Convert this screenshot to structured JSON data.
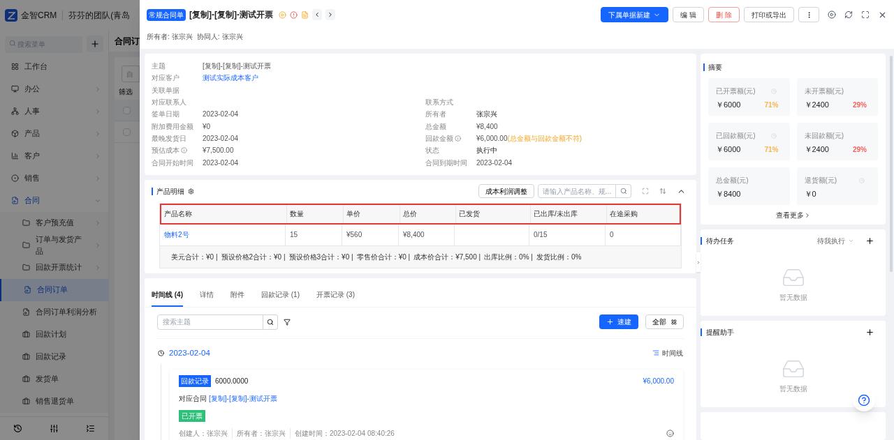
{
  "app": {
    "logo_text": "金智CRM",
    "team": "芬芬的团队(青岛",
    "search_placeholder": "搜索菜单",
    "menu": [
      {
        "label": "工作台",
        "kind": "link",
        "selected": false
      },
      {
        "label": "办公",
        "kind": "group",
        "expanded": false,
        "selected": false
      },
      {
        "label": "人事",
        "kind": "group",
        "expanded": false,
        "selected": false
      },
      {
        "label": "产品",
        "kind": "group",
        "expanded": false,
        "selected": false
      },
      {
        "label": "客户",
        "kind": "group",
        "expanded": false,
        "selected": false
      },
      {
        "label": "销售",
        "kind": "group",
        "expanded": false,
        "selected": false
      },
      {
        "label": "合同",
        "kind": "group",
        "expanded": true,
        "selected": false,
        "children": [
          {
            "label": "客户预充值",
            "kind": "folder",
            "selected": false
          },
          {
            "label": "订单与发货产品",
            "kind": "folder",
            "selected": false
          },
          {
            "label": "回款开票统计",
            "kind": "folder",
            "selected": false
          },
          {
            "label": "合同订单",
            "kind": "page",
            "selected": true
          },
          {
            "label": "合同订单利润分析",
            "kind": "page",
            "selected": false
          },
          {
            "label": "回款计划",
            "kind": "case",
            "selected": false
          },
          {
            "label": "回款记录",
            "kind": "case",
            "selected": false
          },
          {
            "label": "发货单",
            "kind": "case",
            "selected": false
          },
          {
            "label": "销售退货单",
            "kind": "case",
            "selected": false
          }
        ]
      }
    ],
    "page_title": "合同订",
    "filter_value": "自",
    "filter_label": "筛选",
    "table_rows": [
      {
        "checked": false
      },
      {
        "checked": false
      }
    ]
  },
  "drawer": {
    "type_badge": "常规合同单",
    "title": "[复制]-[复制]-测试开票",
    "actions": [
      {
        "label": "下属单据新建",
        "kind": "primary"
      },
      {
        "label": "编 辑",
        "kind": "default"
      },
      {
        "label": "删 除",
        "kind": "danger"
      },
      {
        "label": "打印或导出",
        "kind": "default"
      }
    ],
    "people": [
      {
        "label": "所有者:",
        "value": "张宗兴"
      },
      {
        "label": "协同人:",
        "value": "张宗兴"
      }
    ],
    "info_rows": [
      {
        "left": {
          "label": "主题",
          "value": "[复制]-[复制]-测试开票"
        }
      },
      {
        "left": {
          "label": "对应客户",
          "value": "测试实际成本客户",
          "kind": "link"
        }
      },
      {
        "left": {
          "label": "关联单据"
        }
      },
      {
        "left": {
          "label": "对应联系人"
        },
        "right": {
          "label": "联系方式"
        }
      },
      {
        "left": {
          "label": "签单日期",
          "value": "2023-02-04"
        },
        "right": {
          "label": "所有者",
          "value": "张宗兴",
          "kind": "strong"
        }
      },
      {
        "left": {
          "label": "附加费用金额",
          "value": "¥0"
        },
        "right": {
          "label": "总金额",
          "value": "¥8,400"
        }
      },
      {
        "left": {
          "label": "最晚发货日",
          "value": "2023-02-04"
        },
        "right": {
          "label": "回款金额",
          "info": true,
          "value": "¥6,000.00",
          "warning": "(总金额与回款金额不符)"
        }
      },
      {
        "left": {
          "label": "预估成本",
          "info": true,
          "value": "¥7,500.00"
        },
        "right": {
          "label": "状态",
          "value": "执行中",
          "kind": "strong"
        }
      },
      {
        "left": {
          "label": "合同开始时间",
          "value": "2023-02-04"
        },
        "right": {
          "label": "合同到期时间",
          "value": "2023-02-04"
        }
      }
    ],
    "products": {
      "title": "产品明细",
      "adjust_button": "成本利润调整",
      "search_placeholder": "请输入产品名称、规...",
      "columns": [
        "产品名称",
        "数量",
        "单价",
        "总价",
        "已发货",
        "已出库/未出库",
        "在途采购"
      ],
      "rows": [
        {
          "cells": [
            "物料2号",
            "15",
            "¥560",
            "¥8,400",
            null,
            "0/15",
            "0"
          ]
        }
      ],
      "totals": [
        "美元合计：¥0 |",
        "预设价格2合计：¥0 |",
        "预设价格3合计：¥0 |",
        "零售价合计：¥0 |",
        "成本价合计：¥7,500 |",
        "出库比例：0% |",
        "发货比例：0%"
      ]
    },
    "tabs": [
      {
        "label": "时间线 (4)",
        "selected": true
      },
      {
        "label": "详情",
        "selected": false
      },
      {
        "label": "附件",
        "selected": false
      },
      {
        "label": "回款记录 (1)",
        "selected": false
      },
      {
        "label": "开票记录 (3)",
        "selected": false
      }
    ],
    "timeline": {
      "search_placeholder": "搜索主题",
      "quick_button": "速建",
      "all_button": "全部",
      "date": "2023-02-04",
      "view_toggle": "时间线",
      "entries": [
        {
          "tag": "回款记录",
          "number": "6000.0000",
          "amount": "¥6,000.00",
          "relation_label": "对应合同",
          "relation_link": "[复制]-[复制]-测试开票",
          "status": "已开票",
          "meta": [
            "创建人：张宗兴",
            "所有者：张宗兴",
            "创建时间：2023-02-04 08:40:26"
          ]
        }
      ]
    },
    "summary": {
      "title": "摘要",
      "more": "查看更多",
      "stats": [
        {
          "label": "已开票额(元)",
          "value": "￥6000",
          "percent": "71%",
          "color": "#f5b454",
          "clock": true
        },
        {
          "label": "未开票额(元)",
          "value": "￥2400",
          "percent": "29%",
          "color": "#f2625c",
          "clock": false
        },
        {
          "label": "已回款额(元)",
          "value": "￥6000",
          "percent": "71%",
          "color": "#f5b454",
          "clock": true
        },
        {
          "label": "未回款额(元)",
          "value": "￥2400",
          "percent": "29%",
          "color": "#f2625c",
          "clock": false
        },
        {
          "label": "总金额(元)",
          "value": "￥8400",
          "clock": false
        },
        {
          "label": "退货额(元)",
          "value": "￥0",
          "clock": true
        }
      ]
    },
    "tasks": {
      "title": "待办任务",
      "filter": "待我执行",
      "empty": "暂无数据"
    },
    "reminders": {
      "title": "提醒助手",
      "empty": "暂无数据"
    }
  }
}
